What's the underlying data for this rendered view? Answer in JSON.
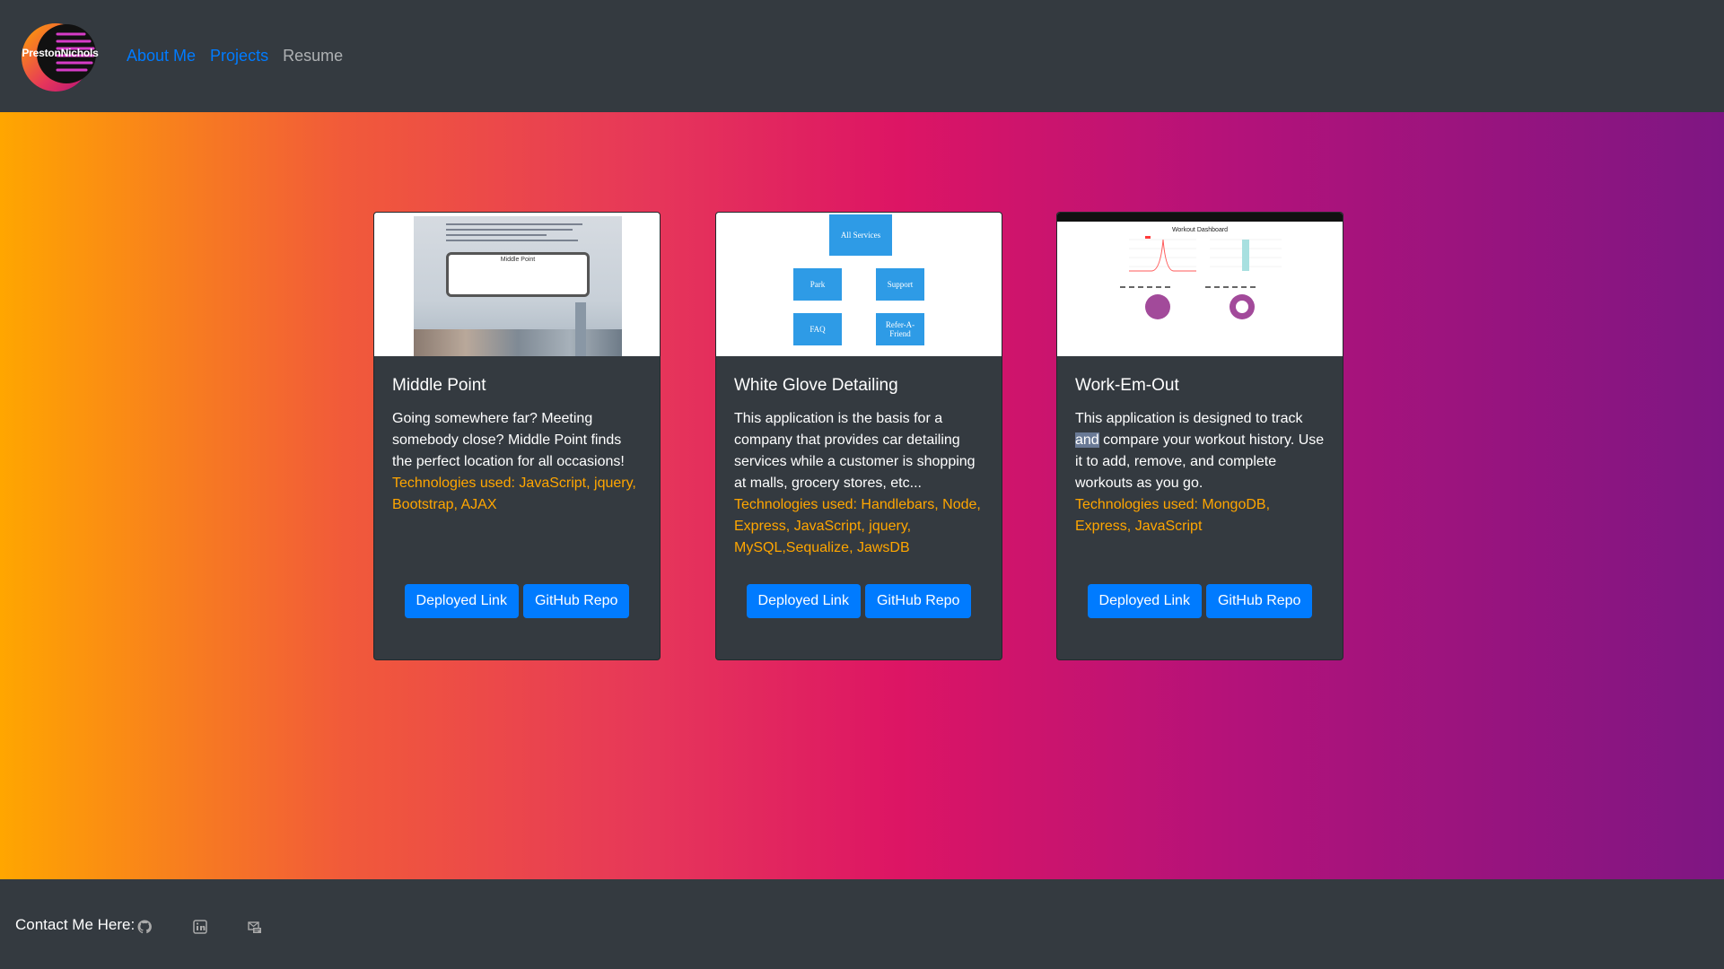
{
  "nav": {
    "logo_text": "PrestonNichols",
    "links": [
      {
        "label": "About Me"
      },
      {
        "label": "Projects"
      },
      {
        "label": "Resume"
      }
    ]
  },
  "projects": [
    {
      "title": "Middle Point",
      "description": "Going somewhere far? Meeting somebody close? Middle Point finds the perfect location for all occasions!",
      "technologies": "Technologies used: JavaScript, jquery, Bootstrap, AJAX",
      "deployed_label": "Deployed Link",
      "repo_label": "GitHub Repo",
      "thumbnail_title": "Middle Point"
    },
    {
      "title": "White Glove Detailing",
      "description": "This application is the basis for a company that provides car detailing services while a customer is shopping at malls, grocery stores, etc...",
      "technologies": "Technologies used: Handlebars, Node, Express, JavaScript, jquery, MySQL,Sequalize, JawsDB",
      "deployed_label": "Deployed Link",
      "repo_label": "GitHub Repo",
      "thumbnail_boxes": [
        "All Services",
        "Park",
        "Support",
        "FAQ",
        "Refer-A-Friend"
      ]
    },
    {
      "title": "Work-Em-Out",
      "description_pre": "This application is designed to track ",
      "description_highlight": "and",
      "description_post": " compare your workout history. Use it to add, remove, and complete workouts as you go.",
      "technologies": "Technologies used: MongoDB, Express, JavaScript",
      "deployed_label": "Deployed Link",
      "repo_label": "GitHub Repo",
      "thumbnail_title": "Workout Dashboard"
    }
  ],
  "footer": {
    "contact_label": "Contact Me Here:",
    "icons": [
      "github-icon",
      "linkedin-icon",
      "email-icon"
    ]
  },
  "colors": {
    "nav_bg": "#343a40",
    "link": "#007bff",
    "tech_text": "#ffa600",
    "button": "#007bff",
    "gradient_start": "#ffa600",
    "gradient_mid": "#dd1564",
    "gradient_end": "#7e1683"
  }
}
